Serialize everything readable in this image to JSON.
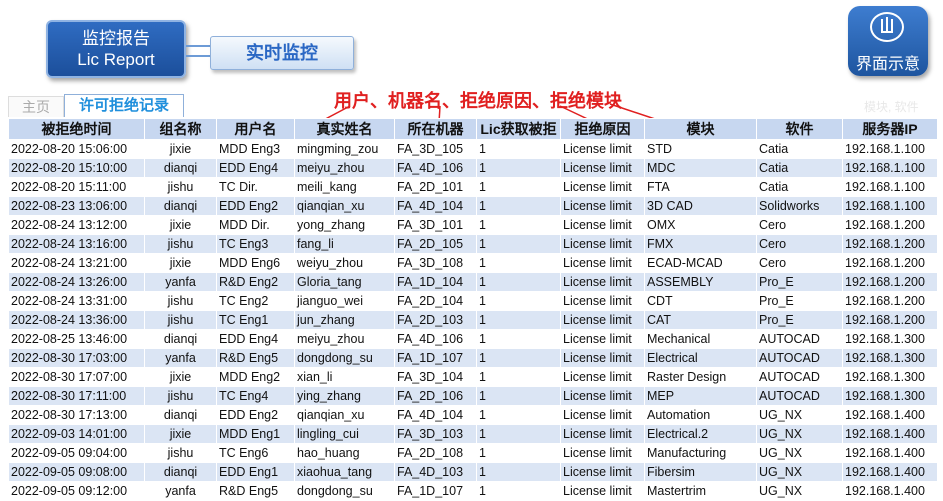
{
  "header": {
    "report_title_line1": "监控报告",
    "report_title_line2": "Lic Report",
    "realtime_button": "实时监控",
    "demo_button": "界面示意"
  },
  "tabs": [
    {
      "label": "主页",
      "active": false
    },
    {
      "label": "许可拒绝记录",
      "active": true
    }
  ],
  "faded_labels": "模块, 软件",
  "annotation": "用户、机器名、拒绝原因、拒绝模块",
  "colors": {
    "header_bg": "#c7d7f0",
    "row_alt": "#dbe5f4",
    "brand_blue": "#1f8fdc",
    "annotation_red": "#e02020"
  },
  "table": {
    "headers": [
      "被拒绝时间",
      "组名称",
      "用户名",
      "真实姓名",
      "所在机器",
      "Lic获取被拒",
      "拒绝原因",
      "模块",
      "软件",
      "服务器IP"
    ],
    "rows": [
      [
        "2022-08-20 15:06:00",
        "jixie",
        "MDD Eng3",
        "mingming_zou",
        "FA_3D_105",
        "1",
        "License limit",
        "STD",
        "Catia",
        "192.168.1.100"
      ],
      [
        "2022-08-20 15:10:00",
        "dianqi",
        "EDD Eng4",
        "meiyu_zhou",
        "FA_4D_106",
        "1",
        "License limit",
        "MDC",
        "Catia",
        "192.168.1.100"
      ],
      [
        "2022-08-20 15:11:00",
        "jishu",
        "TC Dir.",
        "meili_kang",
        "FA_2D_101",
        "1",
        "License limit",
        "FTA",
        "Catia",
        "192.168.1.100"
      ],
      [
        "2022-08-23 13:06:00",
        "dianqi",
        "EDD Eng2",
        "qianqian_xu",
        "FA_4D_104",
        "1",
        "License limit",
        "3D CAD",
        "Solidworks",
        "192.168.1.100"
      ],
      [
        "2022-08-24 13:12:00",
        "jixie",
        "MDD Dir.",
        "yong_zhang",
        "FA_3D_101",
        "1",
        "License limit",
        "OMX",
        "Cero",
        "192.168.1.200"
      ],
      [
        "2022-08-24 13:16:00",
        "jishu",
        "TC Eng3",
        "fang_li",
        "FA_2D_105",
        "1",
        "License limit",
        "FMX",
        "Cero",
        "192.168.1.200"
      ],
      [
        "2022-08-24 13:21:00",
        "jixie",
        "MDD Eng6",
        "weiyu_zhou",
        "FA_3D_108",
        "1",
        "License limit",
        "ECAD-MCAD",
        "Cero",
        "192.168.1.200"
      ],
      [
        "2022-08-24 13:26:00",
        "yanfa",
        "R&D Eng2",
        "Gloria_tang",
        "FA_1D_104",
        "1",
        "License limit",
        "ASSEMBLY",
        "Pro_E",
        "192.168.1.200"
      ],
      [
        "2022-08-24 13:31:00",
        "jishu",
        "TC Eng2",
        "jianguo_wei",
        "FA_2D_104",
        "1",
        "License limit",
        "CDT",
        "Pro_E",
        "192.168.1.200"
      ],
      [
        "2022-08-24 13:36:00",
        "jishu",
        "TC Eng1",
        "jun_zhang",
        "FA_2D_103",
        "1",
        "License limit",
        "CAT",
        "Pro_E",
        "192.168.1.200"
      ],
      [
        "2022-08-25 13:46:00",
        "dianqi",
        "EDD Eng4",
        "meiyu_zhou",
        "FA_4D_106",
        "1",
        "License limit",
        "Mechanical",
        "AUTOCAD",
        "192.168.1.300"
      ],
      [
        "2022-08-30 17:03:00",
        "yanfa",
        "R&D Eng5",
        "dongdong_su",
        "FA_1D_107",
        "1",
        "License limit",
        "Electrical",
        "AUTOCAD",
        "192.168.1.300"
      ],
      [
        "2022-08-30 17:07:00",
        "jixie",
        "MDD Eng2",
        "xian_li",
        "FA_3D_104",
        "1",
        "License limit",
        "Raster Design",
        "AUTOCAD",
        "192.168.1.300"
      ],
      [
        "2022-08-30 17:11:00",
        "jishu",
        "TC Eng4",
        "ying_zhang",
        "FA_2D_106",
        "1",
        "License limit",
        "MEP",
        "AUTOCAD",
        "192.168.1.300"
      ],
      [
        "2022-08-30 17:13:00",
        "dianqi",
        "EDD Eng2",
        "qianqian_xu",
        "FA_4D_104",
        "1",
        "License limit",
        "Automation",
        "UG_NX",
        "192.168.1.400"
      ],
      [
        "2022-09-03 14:01:00",
        "jixie",
        "MDD Eng1",
        "lingling_cui",
        "FA_3D_103",
        "1",
        "License limit",
        "Electrical.2",
        "UG_NX",
        "192.168.1.400"
      ],
      [
        "2022-09-05 09:04:00",
        "jishu",
        "TC Eng6",
        "hao_huang",
        "FA_2D_108",
        "1",
        "License limit",
        "Manufacturing",
        "UG_NX",
        "192.168.1.400"
      ],
      [
        "2022-09-05 09:08:00",
        "dianqi",
        "EDD Eng1",
        "xiaohua_tang",
        "FA_4D_103",
        "1",
        "License limit",
        "Fibersim",
        "UG_NX",
        "192.168.1.400"
      ],
      [
        "2022-09-05 09:12:00",
        "yanfa",
        "R&D Eng5",
        "dongdong_su",
        "FA_1D_107",
        "1",
        "License limit",
        "Mastertrim",
        "UG_NX",
        "192.168.1.400"
      ]
    ]
  }
}
